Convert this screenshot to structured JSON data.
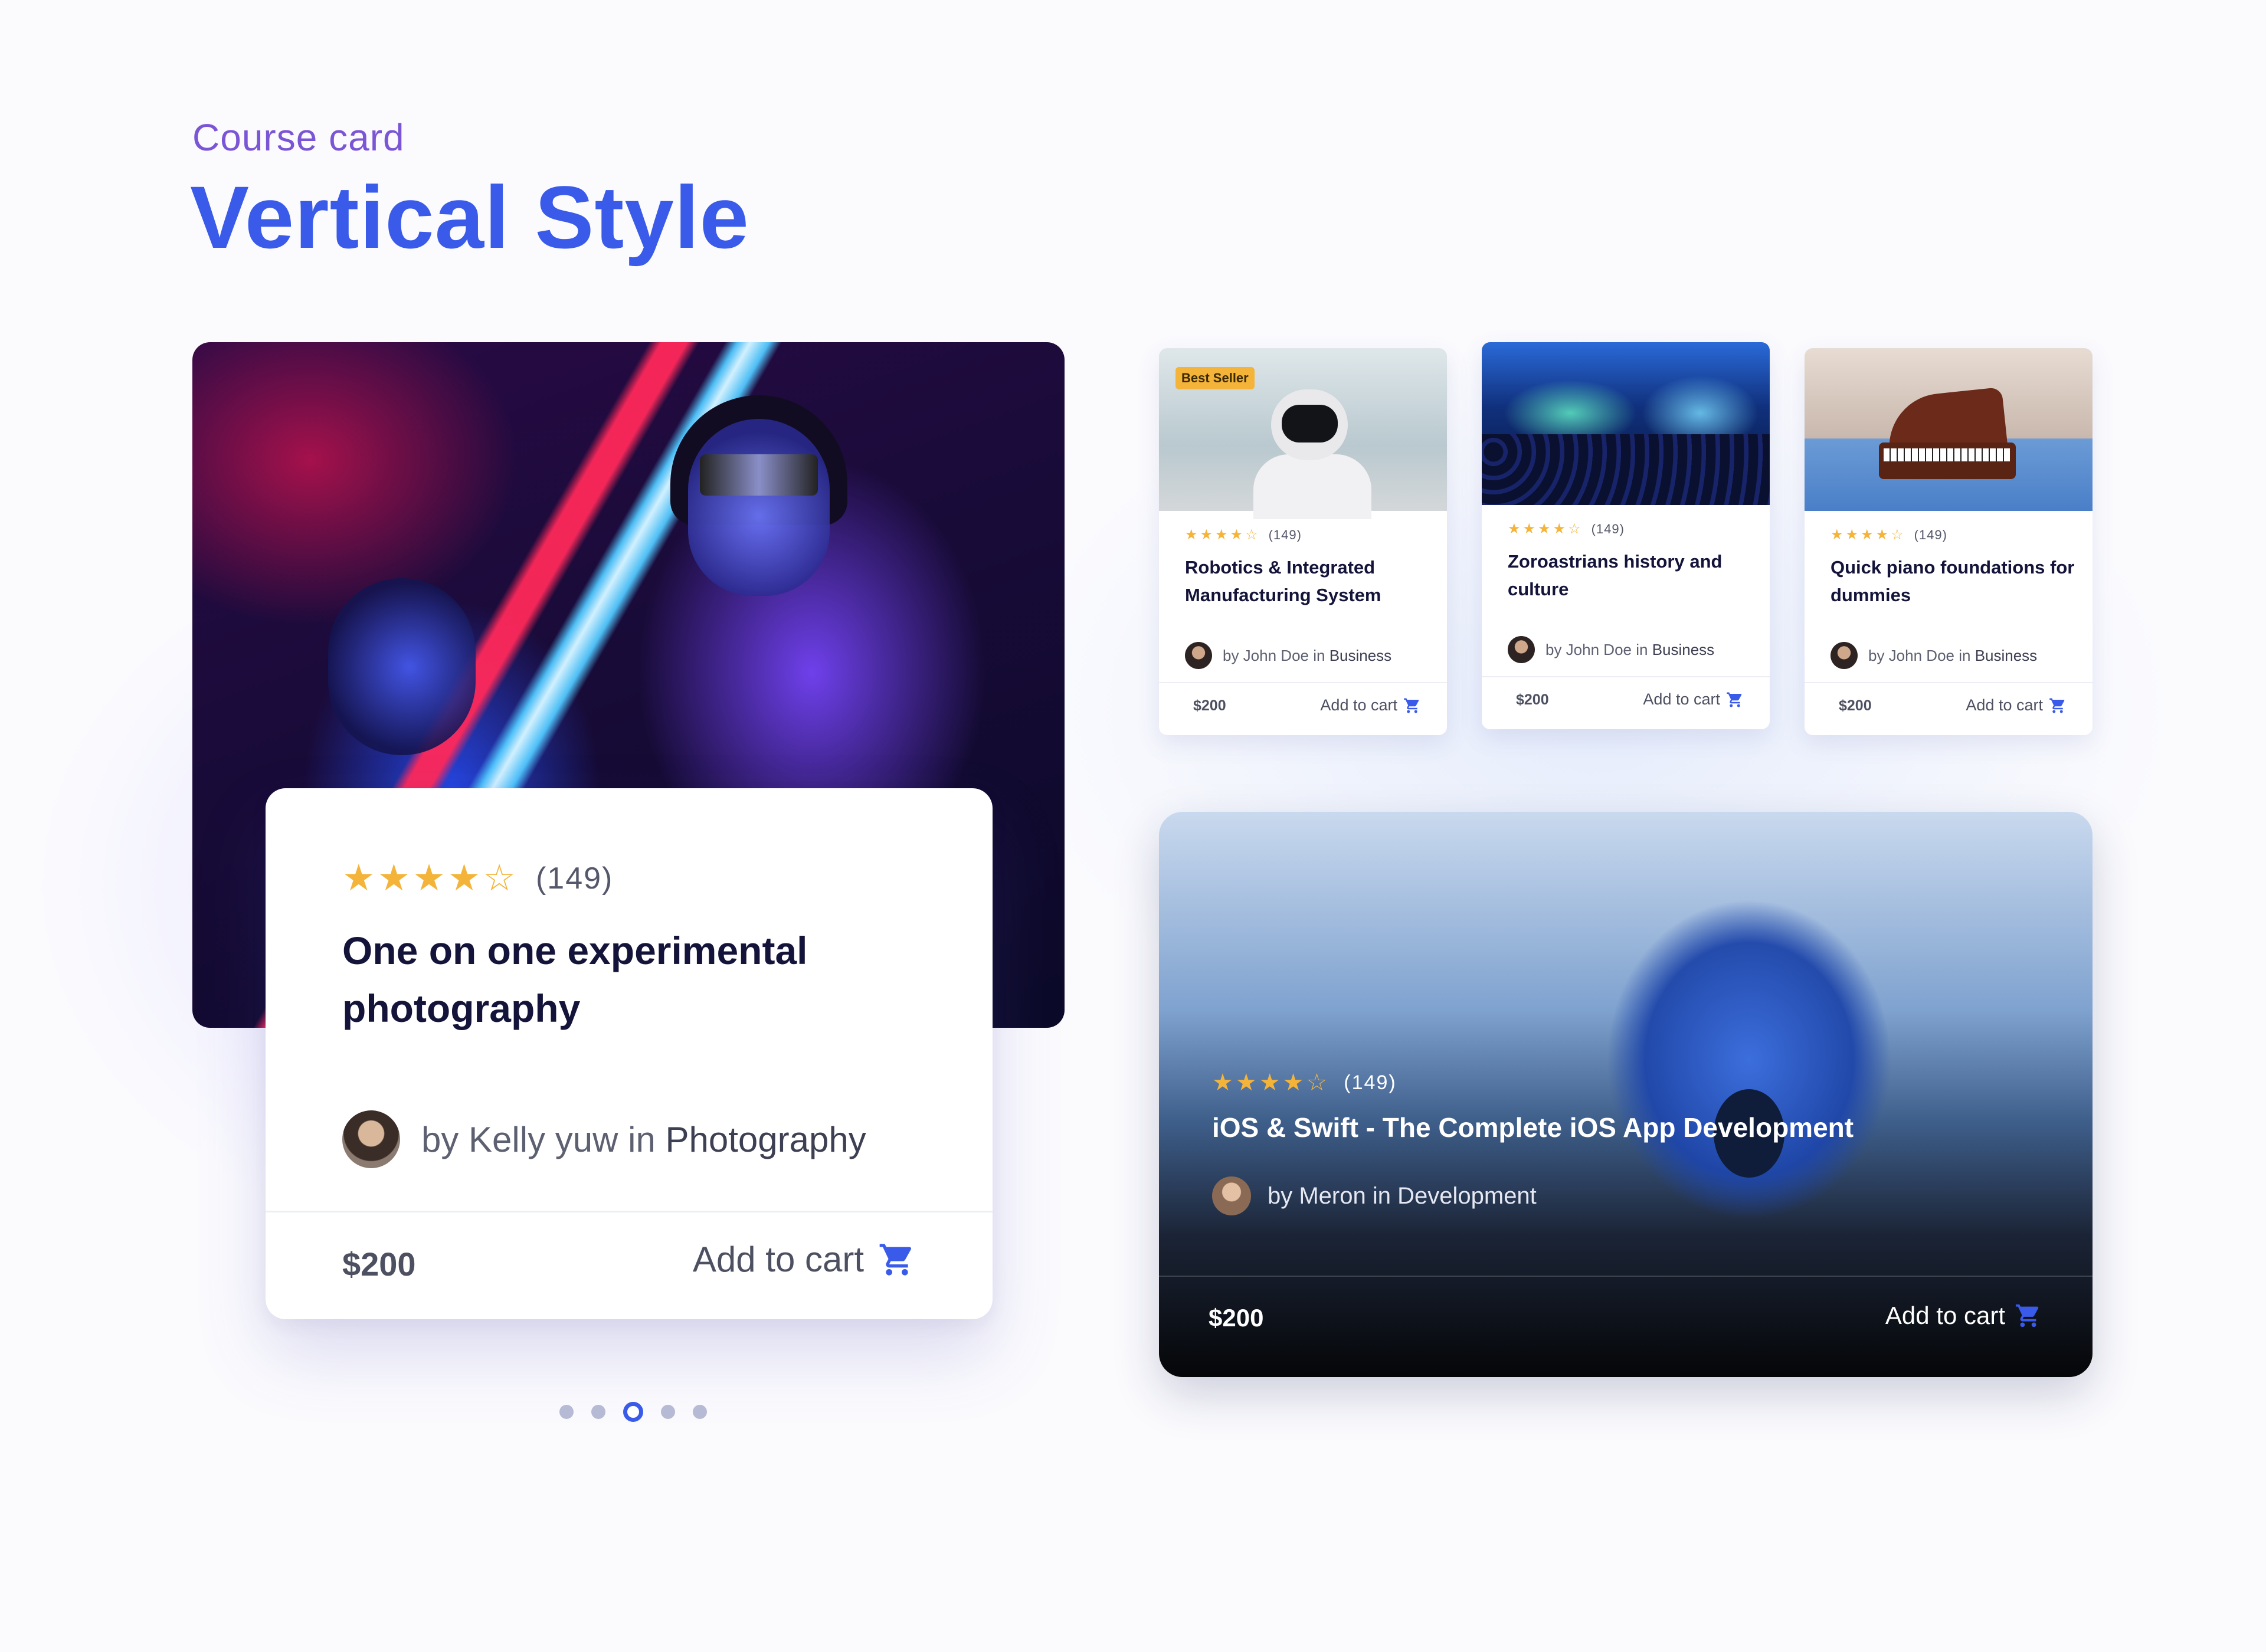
{
  "header": {
    "eyebrow": "Course card",
    "title": "Vertical Style"
  },
  "colors": {
    "accent": "#3a5bea",
    "eyebrow": "#7a55d6",
    "star": "#f4b43a",
    "title_text": "#14143a"
  },
  "featured_card": {
    "rating_stars": 4,
    "rating_max": 5,
    "rating_count": "(149)",
    "title": "One on one experimental photography",
    "author_prefix": "by Kelly yuw in",
    "category": "Photography",
    "price": "$200",
    "cart_label": "Add to cart",
    "cart_icon": "shopping-cart-icon"
  },
  "carousel": {
    "dot_count": 5,
    "active_index": 2
  },
  "small_cards": [
    {
      "badge": "Best Seller",
      "rating_count": "(149)",
      "title": "Robotics & Integrated Manufacturing System",
      "author_prefix": "by John Doe in",
      "category": "Business",
      "price": "$200",
      "cart_label": "Add to cart"
    },
    {
      "rating_count": "(149)",
      "title": "Zoroastrians history and culture",
      "author_prefix": "by John Doe in",
      "category": "Business",
      "price": "$200",
      "cart_label": "Add to cart"
    },
    {
      "rating_count": "(149)",
      "title": "Quick piano foundations for dummies",
      "author_prefix": "by John Doe in",
      "category": "Business",
      "price": "$200",
      "cart_label": "Add to cart"
    }
  ],
  "dark_card": {
    "rating_count": "(149)",
    "title": "iOS & Swift - The Complete iOS App Development",
    "author_prefix": "by Meron in",
    "category": "Development",
    "price": "$200",
    "cart_label": "Add to cart"
  }
}
